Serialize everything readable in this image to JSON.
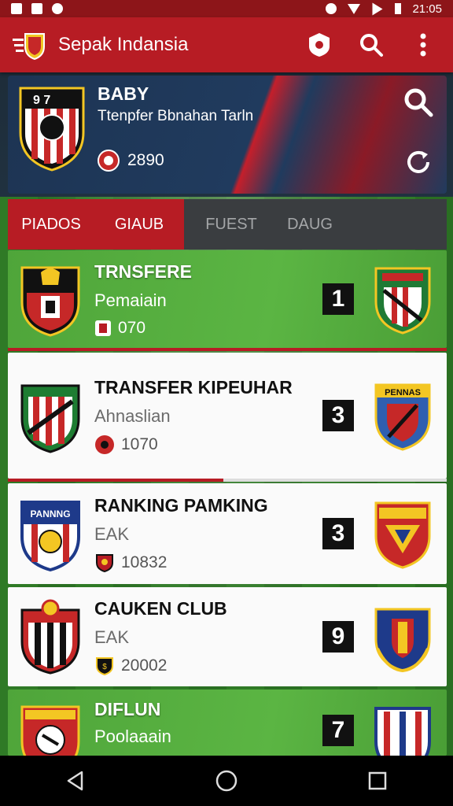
{
  "statusbar": {
    "time": "21:05"
  },
  "app": {
    "title": "Sepak Indansia"
  },
  "profile": {
    "name": "BABY",
    "subtitle": "Ttenpfer Bbnahan Tarln",
    "points": "2890"
  },
  "tabs": [
    {
      "label": "PIADOS",
      "active": true
    },
    {
      "label": "GIAUB",
      "active": true
    },
    {
      "label": "FUEST",
      "active": false
    },
    {
      "label": "DAUG",
      "active": false
    }
  ],
  "cards": [
    {
      "title": "TRNSFERE",
      "subtitle": "Pemaiain",
      "points": "070",
      "rank": "1",
      "crest_text": "",
      "opp_text": ""
    },
    {
      "title": "TRANSFER KIPEUHAR",
      "subtitle": "Ahnaslian",
      "points": "1070",
      "rank": "3",
      "crest_text": "",
      "opp_text": "PENNAS"
    },
    {
      "title": "RANKING PAMKING",
      "subtitle": "EAK",
      "points": "10832",
      "rank": "3",
      "crest_text": "PANNNG",
      "opp_text": ""
    },
    {
      "title": "CAUKEN CLUB",
      "subtitle": "EAK",
      "points": "20002",
      "rank": "9",
      "crest_text": "",
      "opp_text": ""
    },
    {
      "title": "DIFLUN",
      "subtitle": "Poolaaain",
      "points": "",
      "rank": "7",
      "crest_text": "",
      "opp_text": ""
    }
  ],
  "colors": {
    "primary": "#b71c24",
    "active_card": "#4fa53a",
    "banner": "#1d3453"
  },
  "icons": [
    "hamburger-logo-icon",
    "shield-badge-icon",
    "search-icon",
    "more-vert-icon",
    "sync-icon",
    "coin-icon",
    "back-icon",
    "home-icon",
    "recents-icon"
  ]
}
